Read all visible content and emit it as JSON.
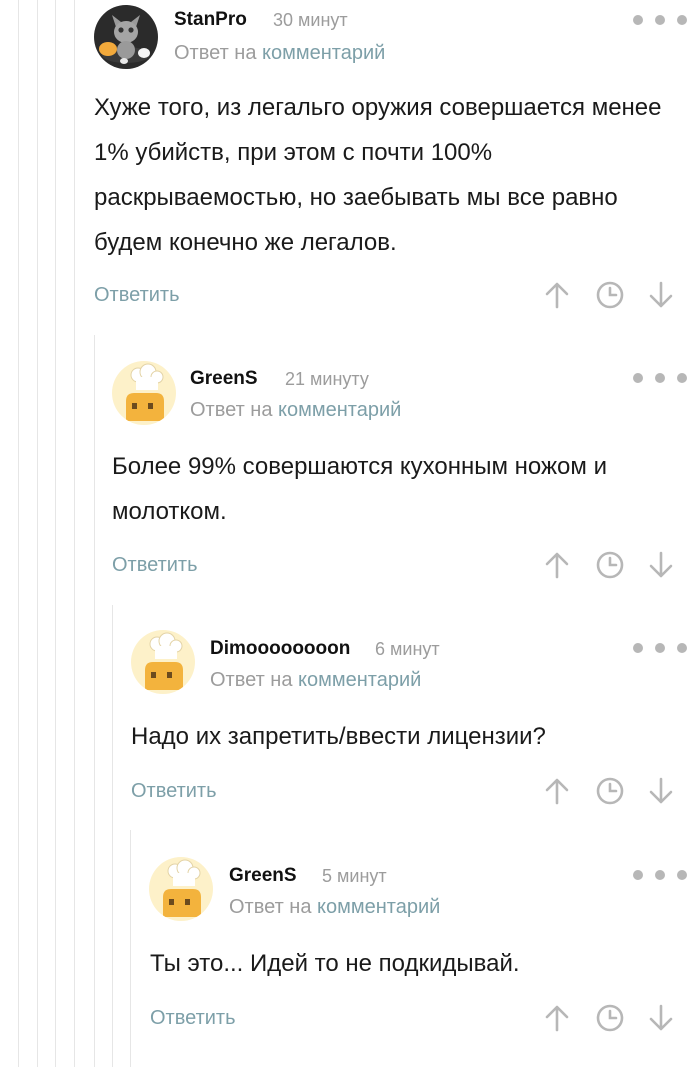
{
  "comments": [
    {
      "username": "StanPro",
      "time": "30 минут",
      "reply_prefix": "Ответ на",
      "reply_link": "комментарий",
      "text": "Хуже того, из легальго оружия совершается менее 1% убийств, при этом с почти 100% раскрываемостью, но заебывать мы все равно будем конечно же легалов.",
      "reply_label": "Ответить",
      "avatar_icon": "cat-avatar-icon"
    },
    {
      "username": "GreenS",
      "time": "21 минуту",
      "reply_prefix": "Ответ на",
      "reply_link": "комментарий",
      "text": "Более 99% совершаются кухонным ножом и молотком.",
      "reply_label": "Ответить",
      "avatar_icon": "chef-avatar-icon"
    },
    {
      "username": "Dimoooooooon",
      "time": "6 минут",
      "reply_prefix": "Ответ на",
      "reply_link": "комментарий",
      "text": "Надо их запретить/ввести лицензии?",
      "reply_label": "Ответить",
      "avatar_icon": "chef-avatar-icon"
    },
    {
      "username": "GreenS",
      "time": "5 минут",
      "reply_prefix": "Ответ на",
      "reply_link": "комментарий",
      "text": "Ты это... Идей то не подкидывай.",
      "reply_label": "Ответить",
      "avatar_icon": "chef-avatar-icon"
    }
  ],
  "colors": {
    "accent": "#7d9fa8",
    "muted": "#9c9c9c",
    "icon": "#b7b7b7",
    "thread_line": "#e6e6e6"
  }
}
